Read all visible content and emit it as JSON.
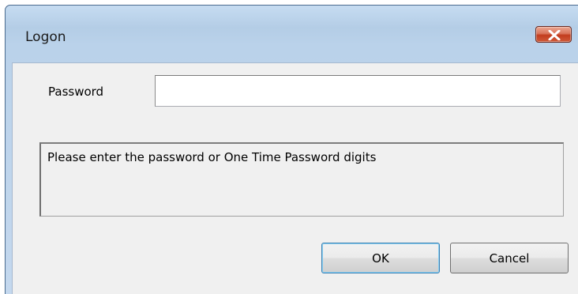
{
  "window": {
    "title": "Logon",
    "close_icon": "close-icon"
  },
  "form": {
    "password_label": "Password",
    "password_value": "",
    "password_placeholder": ""
  },
  "message": {
    "text": "Please enter the password or One Time Password digits"
  },
  "buttons": {
    "ok_label": "OK",
    "cancel_label": "Cancel"
  },
  "colors": {
    "titlebar": "#bad2ea",
    "client_bg": "#f0f0f0",
    "close_button": "#c23d1e",
    "default_button_border": "#3c7fb1"
  }
}
